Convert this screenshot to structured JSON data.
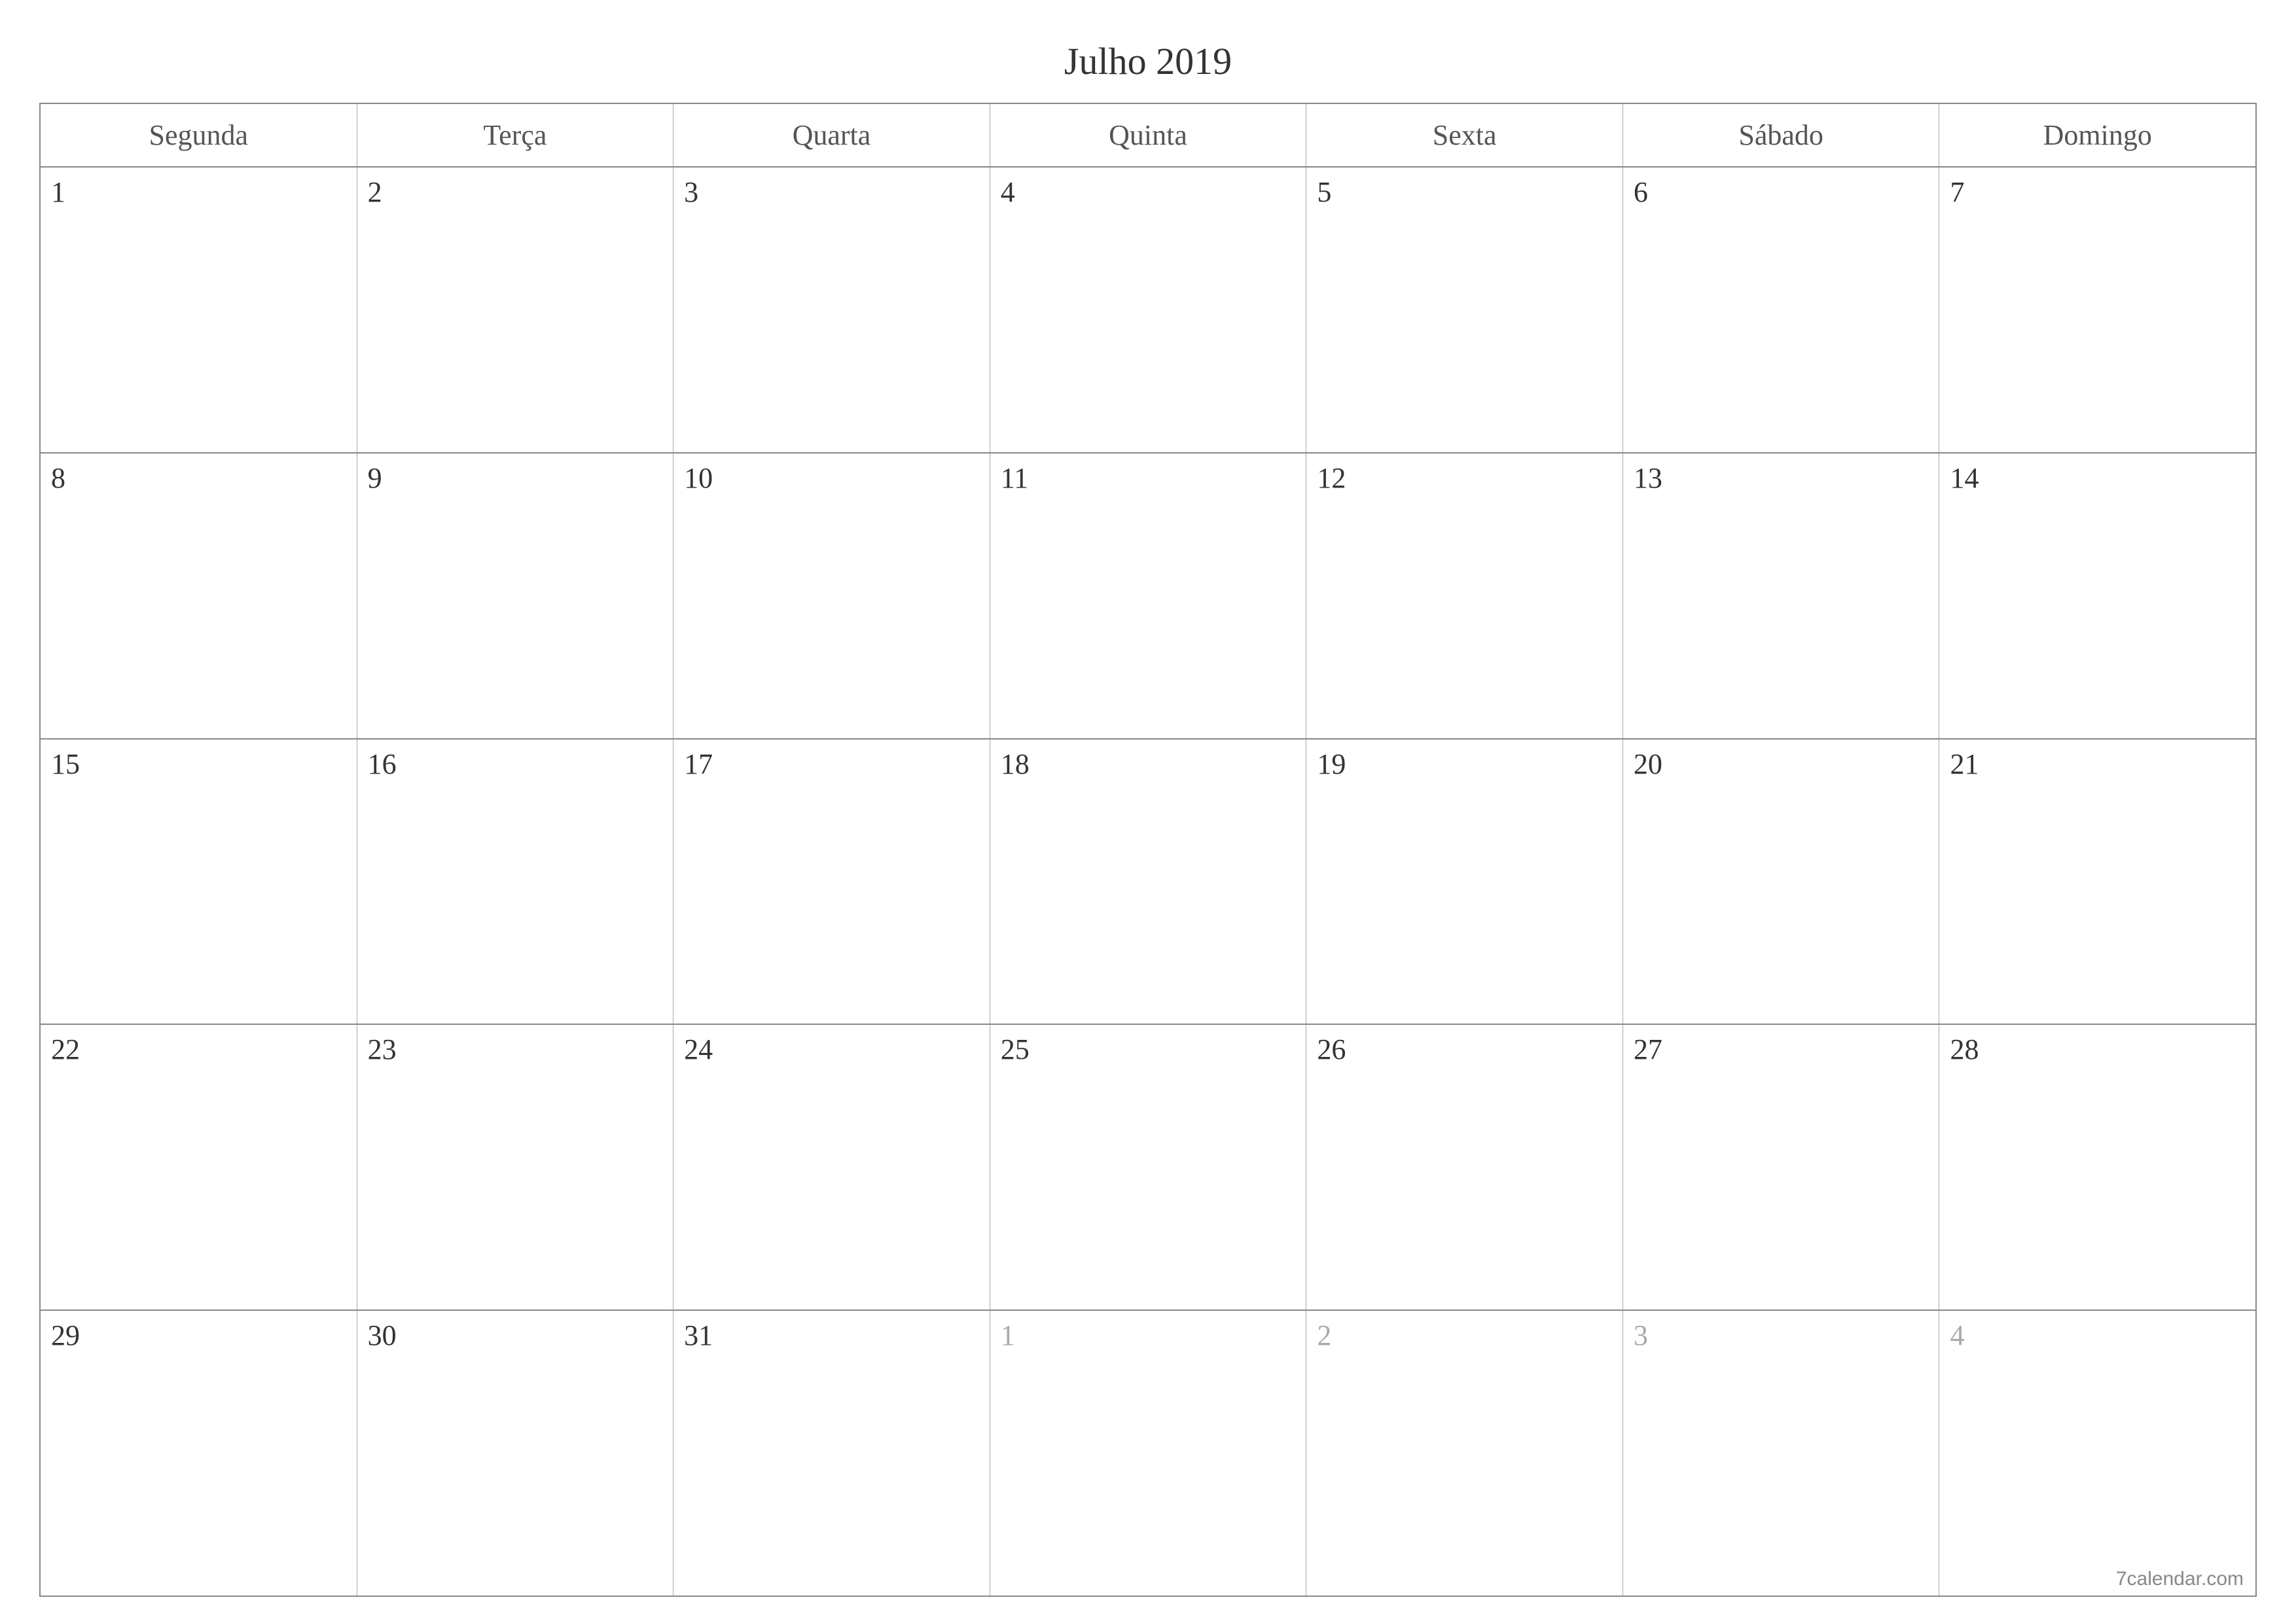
{
  "title": "Julho 2019",
  "weekdays": [
    "Segunda",
    "Terça",
    "Quarta",
    "Quinta",
    "Sexta",
    "Sábado",
    "Domingo"
  ],
  "weeks": [
    [
      {
        "day": "1",
        "otherMonth": false
      },
      {
        "day": "2",
        "otherMonth": false
      },
      {
        "day": "3",
        "otherMonth": false
      },
      {
        "day": "4",
        "otherMonth": false
      },
      {
        "day": "5",
        "otherMonth": false
      },
      {
        "day": "6",
        "otherMonth": false
      },
      {
        "day": "7",
        "otherMonth": false
      }
    ],
    [
      {
        "day": "8",
        "otherMonth": false
      },
      {
        "day": "9",
        "otherMonth": false
      },
      {
        "day": "10",
        "otherMonth": false
      },
      {
        "day": "11",
        "otherMonth": false
      },
      {
        "day": "12",
        "otherMonth": false
      },
      {
        "day": "13",
        "otherMonth": false
      },
      {
        "day": "14",
        "otherMonth": false
      }
    ],
    [
      {
        "day": "15",
        "otherMonth": false
      },
      {
        "day": "16",
        "otherMonth": false
      },
      {
        "day": "17",
        "otherMonth": false
      },
      {
        "day": "18",
        "otherMonth": false
      },
      {
        "day": "19",
        "otherMonth": false
      },
      {
        "day": "20",
        "otherMonth": false
      },
      {
        "day": "21",
        "otherMonth": false
      }
    ],
    [
      {
        "day": "22",
        "otherMonth": false
      },
      {
        "day": "23",
        "otherMonth": false
      },
      {
        "day": "24",
        "otherMonth": false
      },
      {
        "day": "25",
        "otherMonth": false
      },
      {
        "day": "26",
        "otherMonth": false
      },
      {
        "day": "27",
        "otherMonth": false
      },
      {
        "day": "28",
        "otherMonth": false
      }
    ],
    [
      {
        "day": "29",
        "otherMonth": false
      },
      {
        "day": "30",
        "otherMonth": false
      },
      {
        "day": "31",
        "otherMonth": false
      },
      {
        "day": "1",
        "otherMonth": true
      },
      {
        "day": "2",
        "otherMonth": true
      },
      {
        "day": "3",
        "otherMonth": true
      },
      {
        "day": "4",
        "otherMonth": true
      }
    ]
  ],
  "footer": "7calendar.com"
}
